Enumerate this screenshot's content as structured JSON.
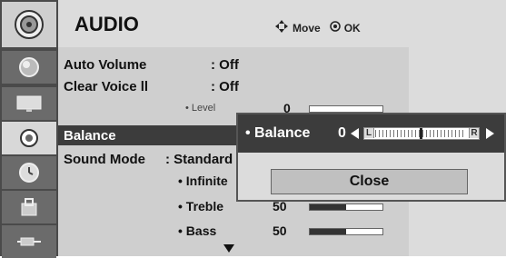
{
  "menu": {
    "title": "AUDIO",
    "hint_move": "Move",
    "hint_ok": "OK"
  },
  "rows": [
    {
      "label": "Auto Volume",
      "value": ": Off"
    },
    {
      "label": "Clear Voice ll",
      "value": ": Off"
    },
    {
      "label": "Balance",
      "value": ""
    },
    {
      "label": "Sound Mode",
      "value": ": Standard"
    }
  ],
  "level": {
    "label": "• Level",
    "value": "0"
  },
  "sound_mode_options": [
    {
      "label": "• Infinite"
    },
    {
      "label": "• Treble",
      "value": "50",
      "fill": 0.5
    },
    {
      "label": "• Bass",
      "value": "50",
      "fill": 0.5
    }
  ],
  "popup": {
    "balance_label": "• Balance",
    "balance_value": "0",
    "left_mark": "L",
    "right_mark": "R",
    "close_label": "Close"
  },
  "icons": [
    "tv-icon",
    "picture-icon",
    "screen-icon",
    "audio-icon",
    "time-icon",
    "lock-icon",
    "input-icon"
  ],
  "colors": {
    "highlight": "#3c3c3c",
    "sidebar": "#4a4a4a",
    "panel": "#cfcfcf"
  }
}
